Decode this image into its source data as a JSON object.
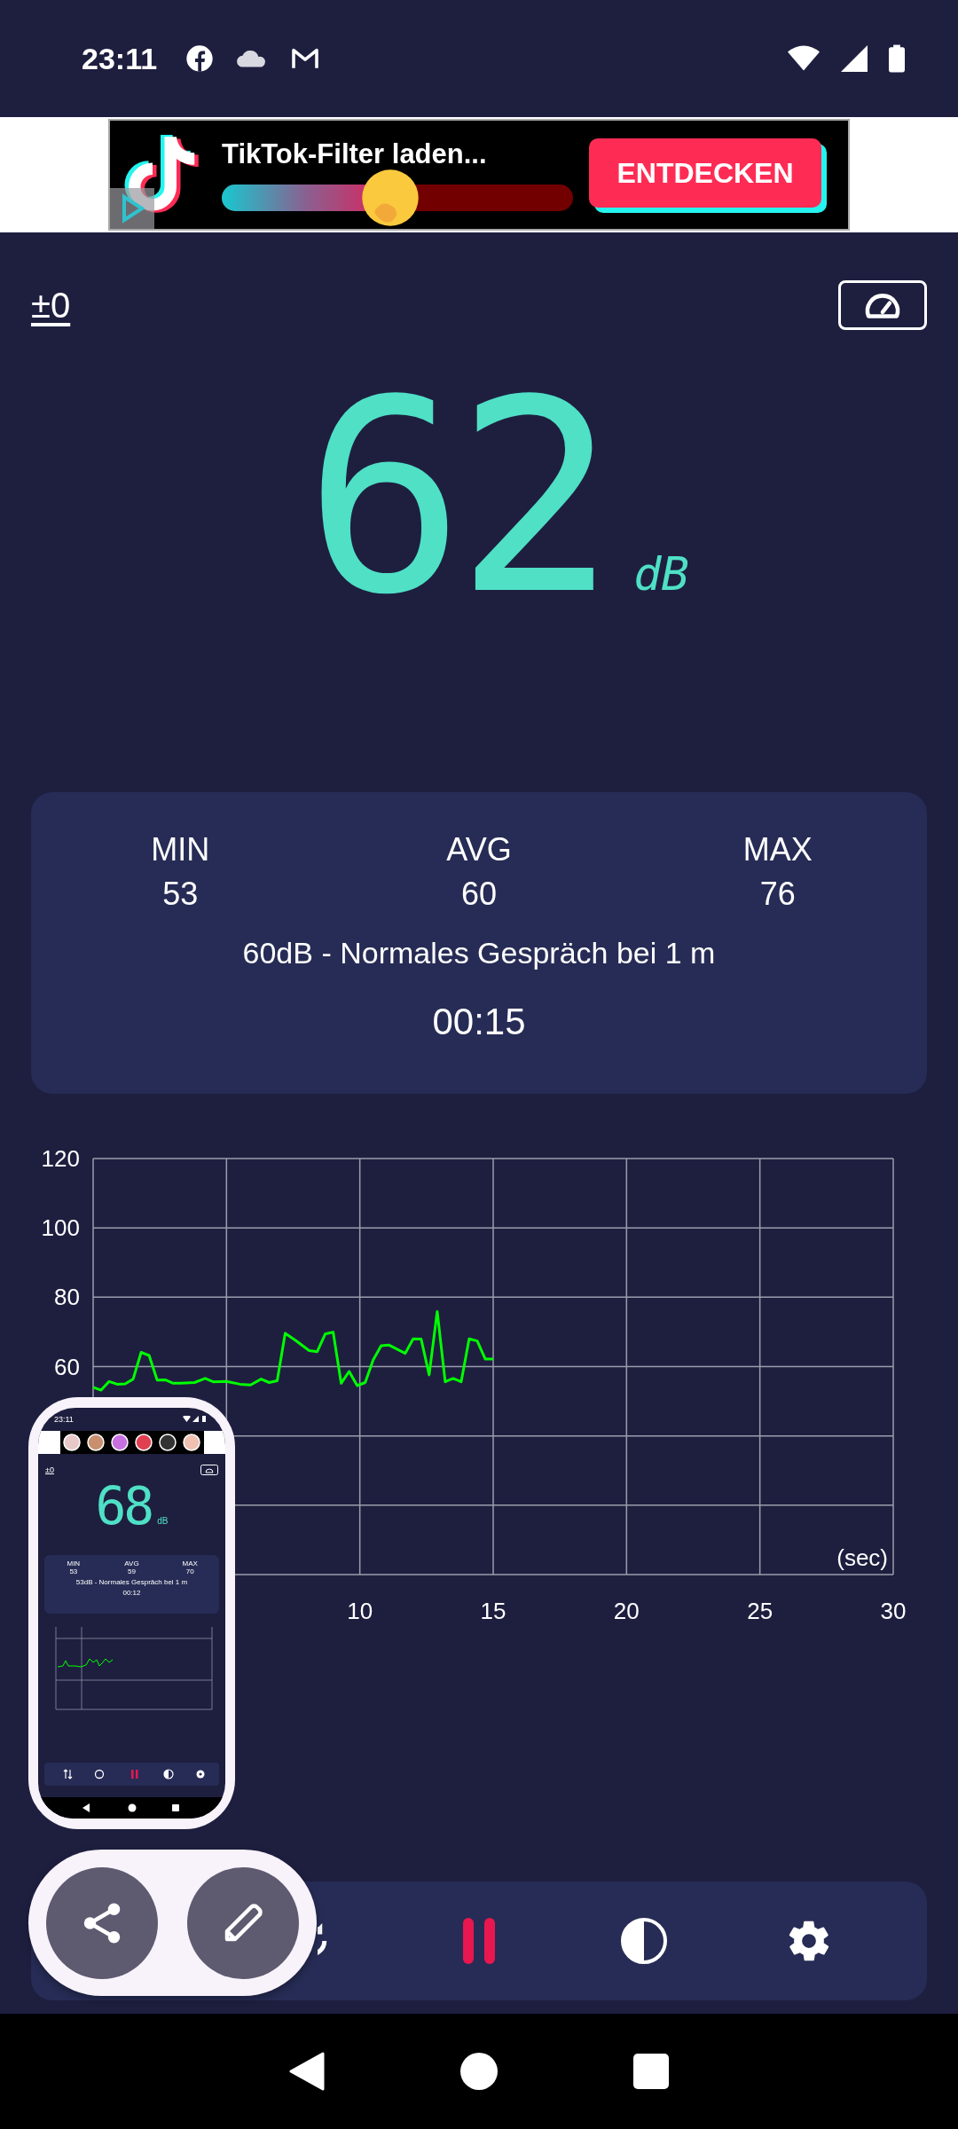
{
  "status_bar": {
    "time": "23:11"
  },
  "ad": {
    "title": "TikTok-Filter laden...",
    "level": 0.48,
    "button": "ENTDECKEN"
  },
  "calibration": "±0",
  "reading": {
    "value": "62",
    "unit": "dB"
  },
  "stats": [
    {
      "label": "MIN",
      "value": "53"
    },
    {
      "label": "AVG",
      "value": "60"
    },
    {
      "label": "MAX",
      "value": "76"
    }
  ],
  "description": "60dB - Normales Gespräch bei 1 m",
  "elapsed": "00:15",
  "chart": {
    "chart_data": {
      "type": "line",
      "grid": true,
      "xlabel": "(sec)",
      "xlim": [
        0,
        30
      ],
      "ylim": [
        0,
        120
      ],
      "xticks": [
        10,
        15,
        20,
        25,
        30
      ],
      "yticks": [
        60,
        80,
        100,
        120
      ],
      "x": [
        0,
        0.3,
        0.6,
        0.9,
        1.2,
        1.5,
        1.8,
        2.1,
        2.4,
        2.7,
        3.0,
        3.3,
        3.8,
        4.2,
        4.5,
        5.0,
        5.5,
        5.9,
        6.3,
        6.6,
        6.9,
        7.2,
        7.6,
        8.1,
        8.4,
        8.7,
        9.0,
        9.3,
        9.6,
        9.9,
        10.2,
        10.5,
        10.8,
        11.1,
        11.7,
        12.0,
        12.3,
        12.6,
        12.9,
        13.2,
        13.5,
        13.8,
        14.1,
        14.4,
        14.7,
        15.0
      ],
      "series": [
        {
          "color": "#00ff00",
          "values": [
            54,
            53.2,
            55.7,
            54.9,
            55,
            56.4,
            64.1,
            63.2,
            56.1,
            56.2,
            55.2,
            55.2,
            55.4,
            56.6,
            55.6,
            55.7,
            54.9,
            54.7,
            56.4,
            55.4,
            55.9,
            69.6,
            67.5,
            64.6,
            64.3,
            69.4,
            69.9,
            55.2,
            58.6,
            54.5,
            55.4,
            61.9,
            66,
            66.2,
            63.8,
            68,
            67.9,
            57.6,
            75.9,
            55.6,
            56.6,
            55.6,
            68,
            67.4,
            62.2,
            62.2
          ]
        }
      ]
    }
  },
  "preview": {
    "time": "23:11",
    "calibration": "±0",
    "value": "68",
    "unit": "dB",
    "stats": [
      {
        "label": "MIN",
        "value": "53"
      },
      {
        "label": "AVG",
        "value": "59"
      },
      {
        "label": "MAX",
        "value": "70"
      }
    ],
    "description": "53dB - Normales Gespräch bei 1 m",
    "elapsed": "00:12"
  }
}
